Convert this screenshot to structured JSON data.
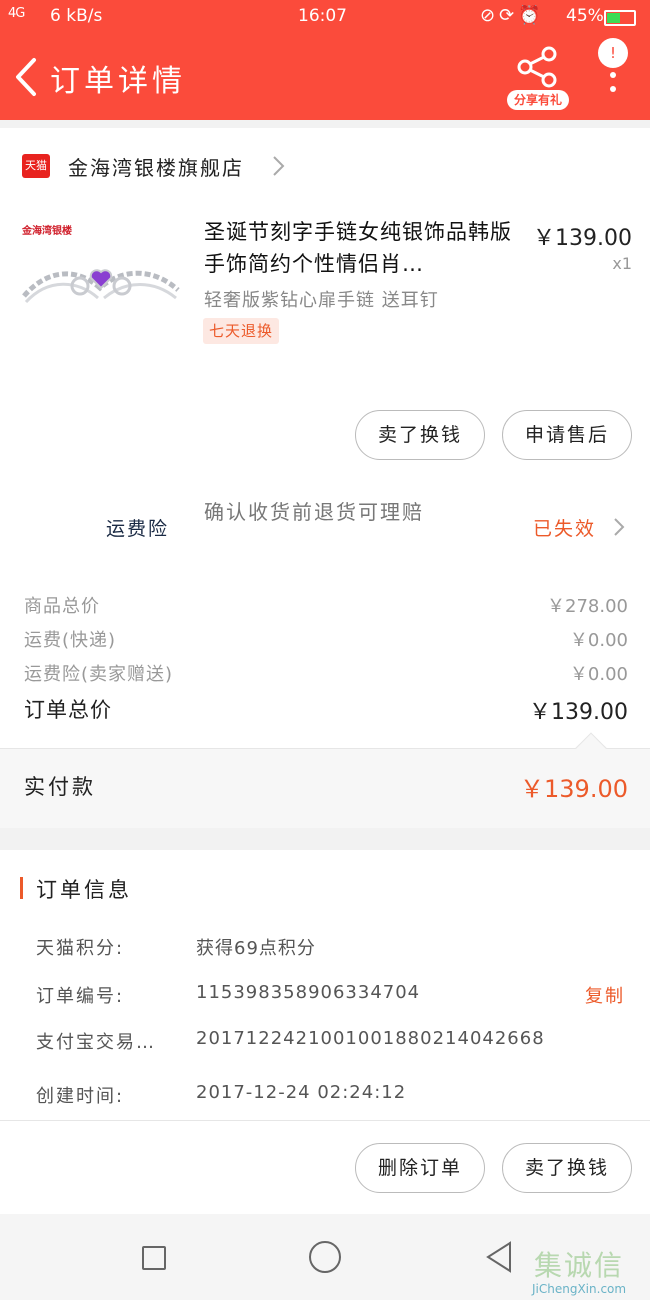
{
  "status_bar": {
    "network": "4G",
    "speed": "6 kB/s",
    "time": "16:07",
    "icons": [
      "no-sim-icon",
      "lock-rotation-icon",
      "alarm-icon"
    ],
    "battery": "45%"
  },
  "header": {
    "title": "订单详情",
    "share_label": "分享有礼",
    "more_badge": "!",
    "bg_color": "#fb4b3b"
  },
  "store": {
    "badge": "天猫",
    "name": "金海湾银楼旗舰店"
  },
  "product": {
    "brand": "金海湾银楼",
    "title": "圣诞节刻字手链女纯银饰品韩版手饰简约个性情侣肖…",
    "price": "￥139.00",
    "quantity": "x1",
    "sku": "轻奢版紫钻心扉手链 送耳钉",
    "tag": "七天退换"
  },
  "product_actions": {
    "sell_label": "卖了换钱",
    "aftersale_label": "申请售后"
  },
  "insurance": {
    "label": "运费险",
    "description": "确认收货前退货可理赔",
    "status": "已失效"
  },
  "summary": [
    {
      "label": "商品总价",
      "value": "￥278.00"
    },
    {
      "label": "运费(快递)",
      "value": "￥0.00"
    },
    {
      "label": "运费险(卖家赠送)",
      "value": "￥0.00"
    }
  ],
  "order_total": {
    "label": "订单总价",
    "value": "￥139.00"
  },
  "payment": {
    "label": "实付款",
    "value": "￥139.00"
  },
  "order_info": {
    "title": "订单信息",
    "rows": [
      {
        "key": "天猫积分:",
        "value": "获得69点积分"
      },
      {
        "key": "订单编号:",
        "value": "115398358906334704",
        "action": "复制"
      },
      {
        "key": "支付宝交易…",
        "value": "2017122421001001880214042668"
      },
      {
        "key": "创建时间:",
        "value": "2017-12-24 02:24:12"
      }
    ]
  },
  "bottom_actions": {
    "delete_label": "删除订单",
    "sell_label": "卖了换钱"
  },
  "watermark": {
    "text": "集诚信",
    "url": "JiChengXin.com"
  },
  "colors": {
    "accent": "#fb4b3b",
    "highlight": "#ec5a2a"
  }
}
